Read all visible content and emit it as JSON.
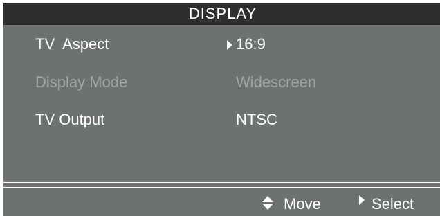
{
  "header": {
    "title": "DISPLAY"
  },
  "menu": {
    "items": [
      {
        "label": "TV  Aspect",
        "value": "16:9",
        "state": "selected"
      },
      {
        "label": "Display Mode",
        "value": "Widescreen",
        "state": "disabled"
      },
      {
        "label": "TV Output",
        "value": "NTSC",
        "state": "normal"
      }
    ]
  },
  "footer": {
    "move_label": "Move",
    "move_icon": "up-down-arrows-icon",
    "select_label": "Select",
    "select_icon": "right-triangle-icon"
  },
  "colors": {
    "panel": "#6e7171",
    "title_bar": "#2e2e2e",
    "text": "#ffffff",
    "disabled_text": "#a3a5a5"
  }
}
